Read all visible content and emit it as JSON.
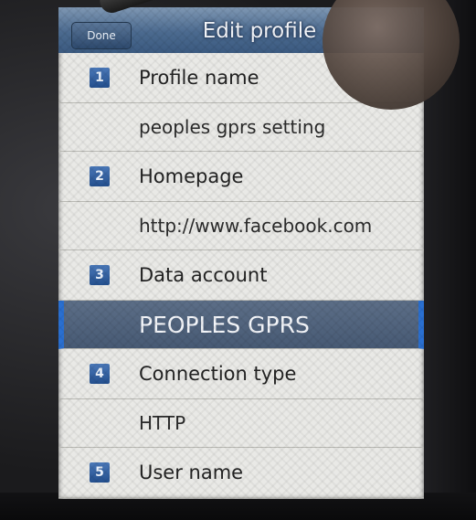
{
  "header": {
    "done_label": "Done",
    "title": "Edit profile"
  },
  "rows": [
    {
      "number": "1",
      "label": "Profile name"
    },
    {
      "value": "peoples gprs setting"
    },
    {
      "number": "2",
      "label": "Homepage"
    },
    {
      "value": "http://www.facebook.com"
    },
    {
      "number": "3",
      "label": "Data account"
    },
    {
      "value": "PEOPLES GPRS",
      "selected": true
    },
    {
      "number": "4",
      "label": "Connection type"
    },
    {
      "value": "HTTP"
    },
    {
      "number": "5",
      "label": "User name"
    }
  ],
  "colors": {
    "header": "#4b6a8f",
    "selected_row": "#52657e",
    "selected_edge": "#2a6fd0",
    "badge": "#2f5f9f"
  }
}
